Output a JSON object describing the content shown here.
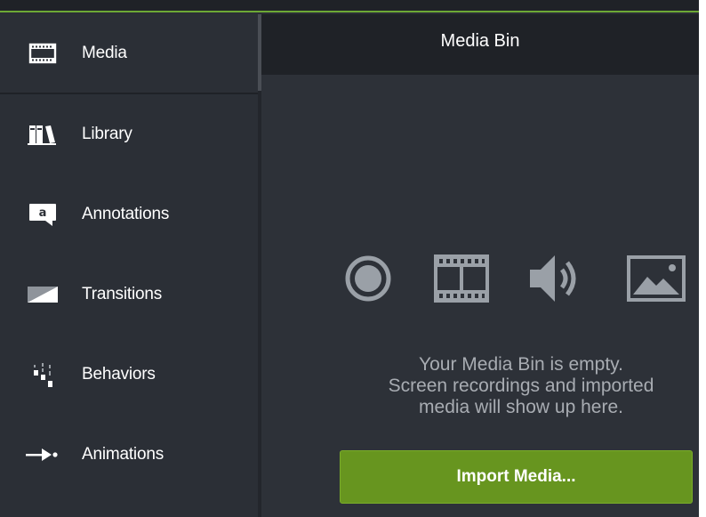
{
  "colors": {
    "accent": "#6da935",
    "button": "#67951f",
    "sidebar_bg": "#2b2f36",
    "header_bg": "#1f2227",
    "muted_text": "#a8acb2"
  },
  "sidebar": {
    "items": [
      {
        "label": "Media",
        "icon": "filmstrip-icon",
        "active": true
      },
      {
        "label": "Library",
        "icon": "library-books-icon",
        "active": false
      },
      {
        "label": "Annotations",
        "icon": "speech-bubble-icon",
        "active": false
      },
      {
        "label": "Transitions",
        "icon": "transition-icon",
        "active": false
      },
      {
        "label": "Behaviors",
        "icon": "behaviors-icon",
        "active": false
      },
      {
        "label": "Animations",
        "icon": "arrow-animation-icon",
        "active": false
      }
    ]
  },
  "main": {
    "title": "Media Bin",
    "empty_icons": [
      "record-icon",
      "film-icon",
      "audio-icon",
      "image-icon"
    ],
    "empty_message": {
      "line1": "Your Media Bin is empty.",
      "line2": "Screen recordings and imported",
      "line3": "media will show up here."
    },
    "import_button_label": "Import Media..."
  }
}
